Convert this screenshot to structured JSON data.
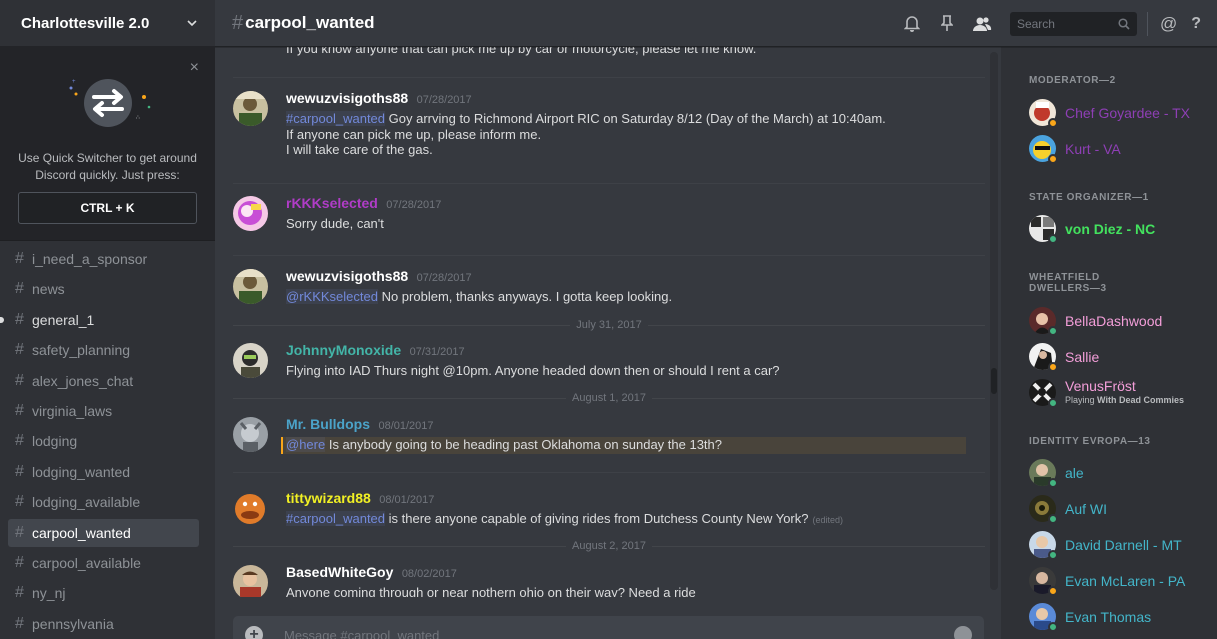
{
  "server": {
    "name": "Charlottesville 2.0"
  },
  "quick_switcher": {
    "text_line1": "Use Quick Switcher to get around",
    "text_line2": "Discord quickly. Just press:",
    "shortcut": "CTRL + K",
    "close": "×"
  },
  "channels": [
    {
      "name": "i_need_a_sponsor",
      "state": "normal"
    },
    {
      "name": "news",
      "state": "normal"
    },
    {
      "name": "general_1",
      "state": "unread"
    },
    {
      "name": "safety_planning",
      "state": "normal"
    },
    {
      "name": "alex_jones_chat",
      "state": "normal"
    },
    {
      "name": "virginia_laws",
      "state": "normal"
    },
    {
      "name": "lodging",
      "state": "normal"
    },
    {
      "name": "lodging_wanted",
      "state": "normal"
    },
    {
      "name": "lodging_available",
      "state": "normal"
    },
    {
      "name": "carpool_wanted",
      "state": "active"
    },
    {
      "name": "carpool_available",
      "state": "normal"
    },
    {
      "name": "ny_nj",
      "state": "normal"
    },
    {
      "name": "pennsylvania",
      "state": "normal"
    }
  ],
  "header": {
    "hash": "#",
    "channel": "carpool_wanted",
    "search_placeholder": "Search",
    "at": "@",
    "help": "?"
  },
  "messages": {
    "cut_off_text": "If you know anyone that can pick me up by car or motorcycle, please let me know.",
    "items": [
      {
        "author": "wewuzvisigoths88",
        "author_color": "#ffffff",
        "timestamp": "07/28/2017",
        "mention": "#carpool_wanted",
        "line1": " Goy arrving to Richmond Airport RIC on Saturday 8/12 (Day of the March) at 10:40am.",
        "line2": "If anyone can pick me up, please inform me.",
        "line3": "I will take care of the gas."
      },
      {
        "author": "rKKKselected",
        "author_color": "#b03cc7",
        "timestamp": "07/28/2017",
        "line1": "Sorry dude, can't"
      },
      {
        "author": "wewuzvisigoths88",
        "author_color": "#ffffff",
        "timestamp": "07/28/2017",
        "mention": "@rKKKselected",
        "line1": " No problem, thanks anyways. I gotta keep looking."
      },
      {
        "author": "JohnnyMonoxide",
        "author_color": "#43b5a8",
        "timestamp": "07/31/2017",
        "line1": "Flying into IAD Thurs night @10pm. Anyone headed down then or should I rent a car?"
      },
      {
        "author": "Mr. Bulldops",
        "author_color": "#4ba3c9",
        "timestamp": "08/01/2017",
        "mention": "@here",
        "line1": " Is anybody going to be heading past Oklahoma on sunday the 13th?"
      },
      {
        "author": "tittywizard88",
        "author_color": "#f1f024",
        "timestamp": "08/01/2017",
        "mention": "#carpool_wanted",
        "line1": " is there anyone capable of giving rides from Dutchess County New York?",
        "edited": "(edited)"
      },
      {
        "author": "BasedWhiteGoy",
        "author_color": "#ffffff",
        "timestamp": "08/02/2017",
        "line1": "Anyone coming through or near nothern ohio on their way?  Need a ride"
      }
    ],
    "dividers": [
      "July 31, 2017",
      "August 1, 2017",
      "August 2, 2017"
    ]
  },
  "composer": {
    "placeholder": "Message #carpool_wanted",
    "add": "+"
  },
  "members": {
    "roles": [
      {
        "title": "MODERATOR—2"
      },
      {
        "title": "STATE ORGANIZER—1"
      },
      {
        "title_line1": "WHEATFIELD",
        "title_line2": "DWELLERS—3"
      },
      {
        "title": "IDENTITY EVROPA—13"
      }
    ],
    "list": [
      {
        "name": "Chef Goyardee - TX",
        "color": "#8e3fb5",
        "status": "idle"
      },
      {
        "name": "Kurt - VA",
        "color": "#8e3fb5",
        "status": "idle"
      },
      {
        "name": "von Diez - NC",
        "color": "#43e25e",
        "status": "online"
      },
      {
        "name": "BellaDashwood",
        "color": "#f39ed9",
        "status": "online"
      },
      {
        "name": "Sallie",
        "color": "#f39ed9",
        "status": "idle"
      },
      {
        "name": "VenusFröst",
        "color": "#f39ed9",
        "status": "online",
        "activity_prefix": "Playing ",
        "activity": "With Dead Commies"
      },
      {
        "name": "ale",
        "color": "#43b5c9",
        "status": "online"
      },
      {
        "name": "Auf WI",
        "color": "#43b5c9",
        "status": "online"
      },
      {
        "name": "David Darnell - MT",
        "color": "#43b5c9",
        "status": "online"
      },
      {
        "name": "Evan McLaren - PA",
        "color": "#43b5c9",
        "status": "idle"
      },
      {
        "name": "Evan Thomas",
        "color": "#43b5c9",
        "status": "online"
      }
    ]
  },
  "colors": {
    "mention": "#7289da",
    "online": "#43b581",
    "idle": "#faa61a",
    "highlight_bar": "#faa61a"
  }
}
